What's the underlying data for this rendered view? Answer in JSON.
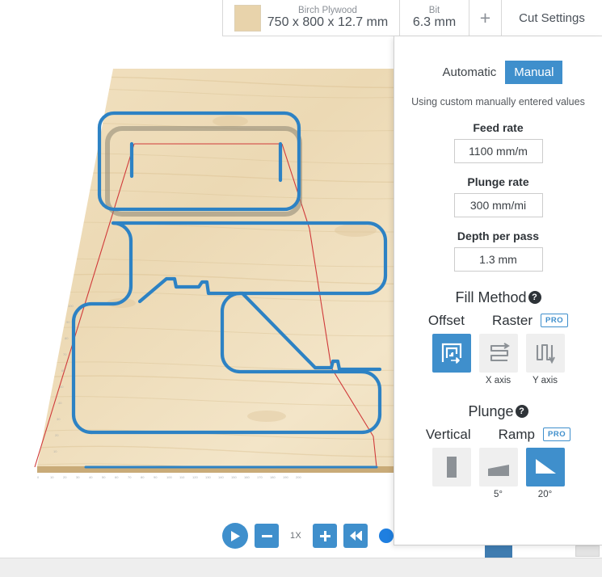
{
  "toolbar": {
    "material_name": "Birch Plywood",
    "material_dims": "750 x 800 x 12.7 mm",
    "material_swatch_color": "#e8d3ab",
    "bit_label": "Bit",
    "bit_value": "6.3 mm",
    "add_icon": "+",
    "cut_settings_label": "Cut Settings"
  },
  "panel": {
    "mode_automatic": "Automatic",
    "mode_manual": "Manual",
    "active_mode": "Manual",
    "note": "Using custom manually entered values",
    "feed_rate_label": "Feed rate",
    "feed_rate_value": "1100 mm/m",
    "plunge_rate_label": "Plunge rate",
    "plunge_rate_value": "300 mm/mi",
    "depth_per_pass_label": "Depth per pass",
    "depth_per_pass_value": "1.3 mm",
    "fill_method": {
      "title": "Fill Method",
      "help": "?",
      "offset_label": "Offset",
      "raster_label": "Raster",
      "pro_badge": "PRO",
      "x_axis_caption": "X axis",
      "y_axis_caption": "Y axis",
      "selected": "Offset"
    },
    "plunge": {
      "title": "Plunge",
      "help": "?",
      "vertical_label": "Vertical",
      "ramp_label": "Ramp",
      "pro_badge": "PRO",
      "ramp5_caption": "5°",
      "ramp20_caption": "20°",
      "selected": "20°"
    },
    "accent_color": "#3f8fcc"
  },
  "playback": {
    "play_icon": "play-icon",
    "decrease_icon": "−",
    "speed_label": "1X",
    "increase_icon": "+",
    "rewind_icon": "⏮",
    "accent_color": "#3f8fcc",
    "handle_color": "#1f7fe0"
  },
  "viewport": {
    "stock_color": "#efdcb8",
    "toolpath_color": "#2d82c4",
    "rapid_move_color": "#d03a3a",
    "description": "3D CNC toolpath preview on birch plywood stock"
  }
}
